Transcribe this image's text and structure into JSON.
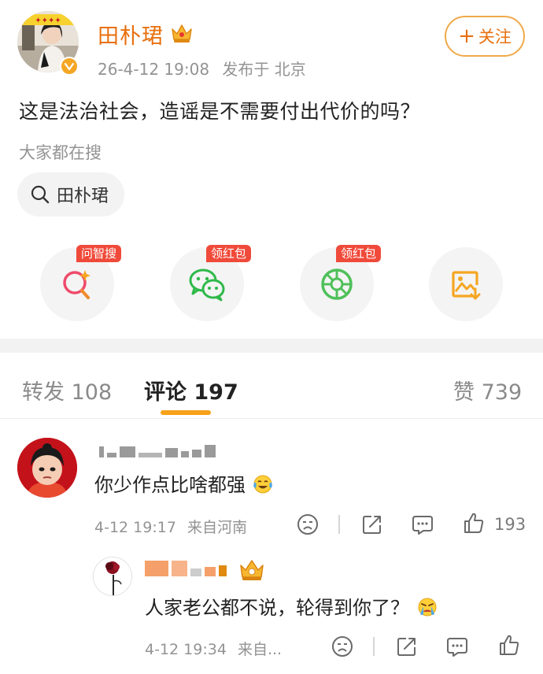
{
  "post": {
    "author_name": "田朴珺",
    "meta_time": "26-4-12 19:08",
    "meta_location": "发布于 北京",
    "follow_label": "关注",
    "follow_plus": "+",
    "text": "这是法治社会，造谣是不需要付出代价的吗？",
    "searching_label": "大家都在搜",
    "search_chip": "田朴珺",
    "actions": [
      {
        "icon": "ai-search-icon",
        "tag": "问智搜"
      },
      {
        "icon": "wechat-icon",
        "tag": "领红包"
      },
      {
        "icon": "moments-icon",
        "tag": "领红包"
      },
      {
        "icon": "save-image-icon",
        "tag": ""
      }
    ],
    "accent_color": "#e8700e"
  },
  "tabs": {
    "repost": "转发 108",
    "comments": "评论 197",
    "likes": "赞 739"
  },
  "comments": [
    {
      "text": "你少作点比啥都强",
      "emoji": "laugh-cry-emoji",
      "time": "4-12 19:17",
      "source": "来自河南",
      "like_count": "193"
    },
    {
      "text": "人家老公都不说，轮得到你了？",
      "emoji": "crying-emoji",
      "time": "4-12 19:34",
      "source": "来自..."
    }
  ]
}
